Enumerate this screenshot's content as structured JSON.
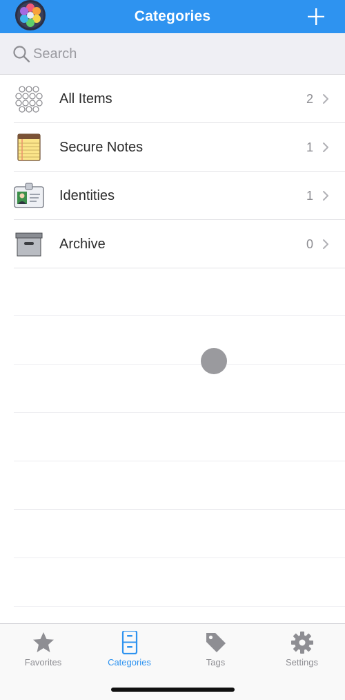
{
  "header": {
    "title": "Categories",
    "logo_icon": "app-logo-icon",
    "add_icon": "plus-icon"
  },
  "search": {
    "placeholder": "Search",
    "value": "",
    "icon": "search-icon"
  },
  "categories": [
    {
      "label": "All Items",
      "count": "2",
      "icon": "all-items-icon"
    },
    {
      "label": "Secure Notes",
      "count": "1",
      "icon": "notepad-icon"
    },
    {
      "label": "Identities",
      "count": "1",
      "icon": "id-card-icon"
    },
    {
      "label": "Archive",
      "count": "0",
      "icon": "archive-box-icon"
    }
  ],
  "tabs": [
    {
      "label": "Favorites",
      "icon": "star-icon",
      "active": false
    },
    {
      "label": "Categories",
      "icon": "file-cabinet-icon",
      "active": true
    },
    {
      "label": "Tags",
      "icon": "tag-icon",
      "active": false
    },
    {
      "label": "Settings",
      "icon": "gear-icon",
      "active": false
    }
  ],
  "colors": {
    "accent": "#2e93f0",
    "inactive": "#8e8e93",
    "background": "#ffffff",
    "search_bg": "#efeff4"
  }
}
